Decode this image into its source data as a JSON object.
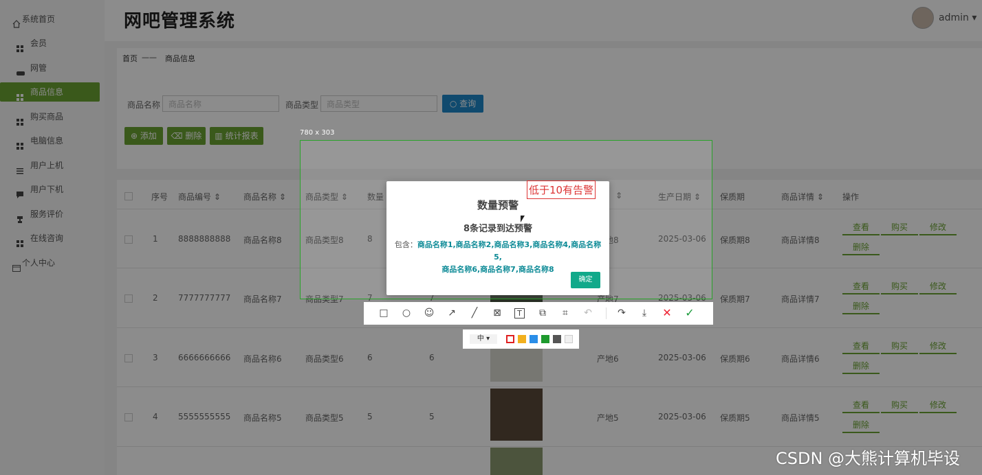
{
  "sidebar": {
    "items": [
      {
        "label": "系统首页",
        "icon": "home-icon"
      },
      {
        "label": "会员",
        "icon": "grid-icon"
      },
      {
        "label": "网管",
        "icon": "gamepad-icon"
      },
      {
        "label": "商品信息",
        "icon": "grid-icon",
        "active": true
      },
      {
        "label": "购买商品",
        "icon": "grid-icon"
      },
      {
        "label": "电脑信息",
        "icon": "grid-icon"
      },
      {
        "label": "用户上机",
        "icon": "list-icon"
      },
      {
        "label": "用户下机",
        "icon": "chat-icon"
      },
      {
        "label": "服务评价",
        "icon": "trophy-icon"
      },
      {
        "label": "在线咨询",
        "icon": "grid-icon"
      },
      {
        "label": "个人中心",
        "icon": "card-icon"
      }
    ]
  },
  "header": {
    "title": "网吧管理系统",
    "user": "admin ▾"
  },
  "breadcrumb": {
    "home": "首页",
    "sep": "——",
    "current": "商品信息"
  },
  "search": {
    "name_label": "商品名称",
    "name_placeholder": "商品名称",
    "type_label": "商品类型",
    "type_placeholder": "商品类型",
    "query_button": "查询"
  },
  "actions": {
    "add": "添加",
    "delete": "删除",
    "report": "统计报表"
  },
  "table": {
    "headers": [
      "序号",
      "商品编号 ⇕",
      "商品名称 ⇕",
      "商品类型 ⇕",
      "数量",
      "⇕",
      "生产日期 ⇕",
      "保质期",
      "商品详情 ⇕",
      "操作"
    ],
    "rows": [
      {
        "idx": "1",
        "code": "8888888888",
        "name": "商品名称8",
        "type": "商品类型8",
        "qty": "8",
        "place": "产地8",
        "date": "2025-03-06",
        "shelf": "保质期8",
        "detail": "商品详情8"
      },
      {
        "idx": "2",
        "code": "7777777777",
        "name": "商品名称7",
        "type": "商品类型7",
        "qty": "7",
        "qty2": "7",
        "place": "产地7",
        "date": "2025-03-06",
        "shelf": "保质期7",
        "detail": "商品详情7"
      },
      {
        "idx": "3",
        "code": "6666666666",
        "name": "商品名称6",
        "type": "商品类型6",
        "qty": "6",
        "qty2": "6",
        "place": "产地6",
        "date": "2025-03-06",
        "shelf": "保质期6",
        "detail": "商品详情6"
      },
      {
        "idx": "4",
        "code": "5555555555",
        "name": "商品名称5",
        "type": "商品类型5",
        "qty": "5",
        "qty2": "5",
        "place": "产地5",
        "date": "2025-03-06",
        "shelf": "保质期5",
        "detail": "商品详情5"
      }
    ],
    "ops": {
      "view": "查看",
      "buy": "购买",
      "edit": "修改",
      "delete": "删除"
    }
  },
  "screenshot_tool": {
    "size": "780 x 303",
    "annotation": "低于10有告警",
    "font_size": "中 ▾",
    "colors": [
      "#e02020",
      "#f2b01e",
      "#2a8ee8",
      "#1e9a2e",
      "#555555",
      "#f0f0f0"
    ]
  },
  "modal": {
    "title": "数量预警",
    "subtitle": "8条记录到达预警",
    "body_prefix": "包含：",
    "body_line1": "商品名称1,商品名称2,商品名称3,商品名称4,商品名称5,",
    "body_line2": "商品名称6,商品名称7,商品名称8",
    "ok": "确定"
  },
  "watermark": "CSDN @大熊计算机毕设"
}
